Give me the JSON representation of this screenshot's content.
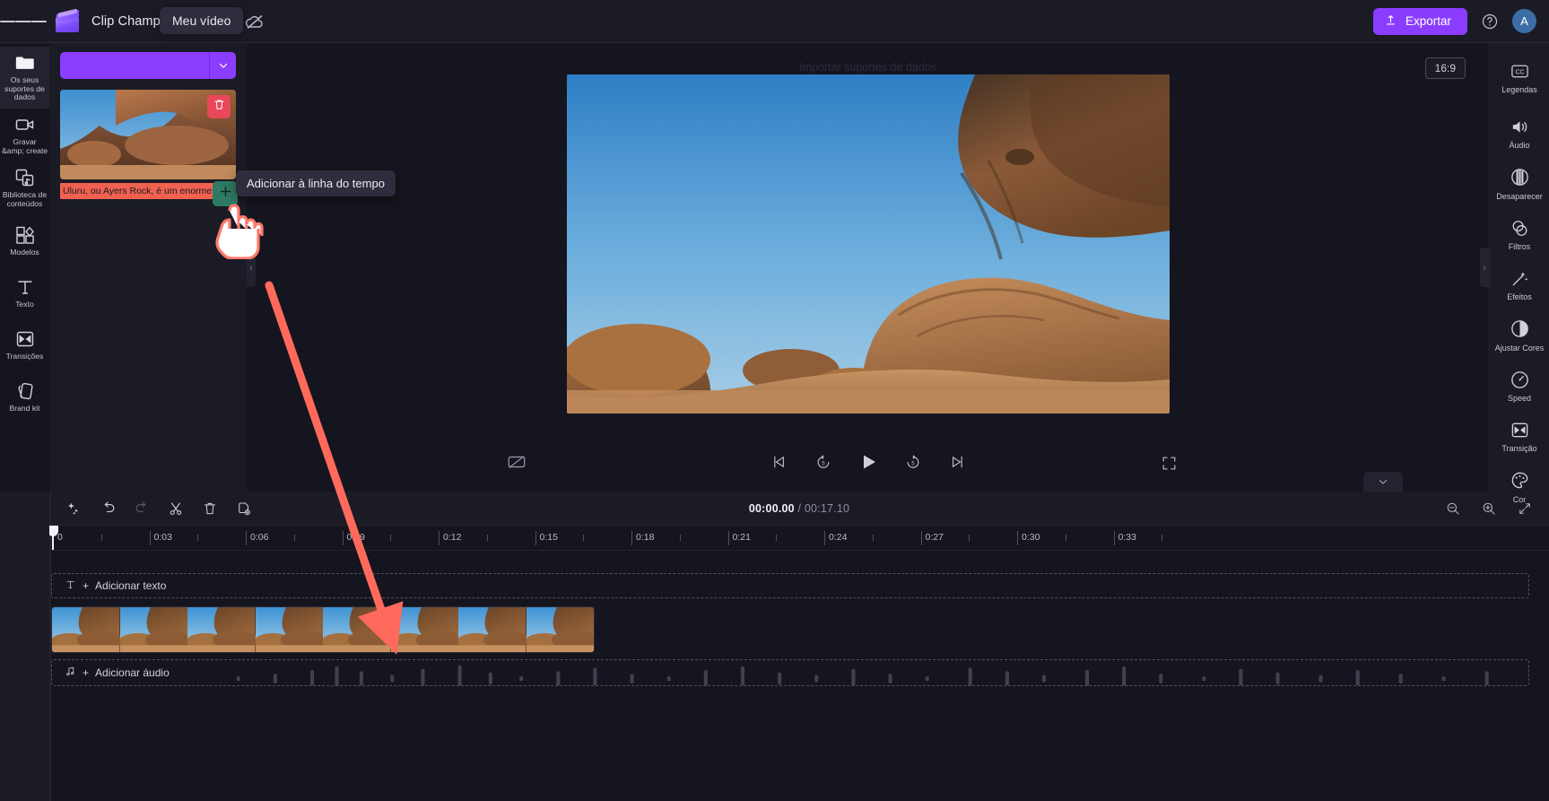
{
  "app": {
    "title": "Clip Champ",
    "project_name": "Meu vídeo",
    "menu_icon": "hamburger-menu-icon",
    "logo_icon": "clipchamp-logo-icon",
    "cloud_off_icon": "cloud-off-icon"
  },
  "topbar": {
    "export_label": "Exportar",
    "export_icon": "upload-icon",
    "help_icon": "help-circle-icon",
    "avatar_initial": "A",
    "accent_color": "#8b3dff",
    "avatar_color": "#3b6ea5"
  },
  "left_rail": {
    "items": [
      {
        "label": "Os seus suportes de dados",
        "icon": "folder-icon",
        "active": true
      },
      {
        "label": "Gravar &amp; create",
        "icon": "video-camera-icon",
        "active": false
      },
      {
        "label": "Biblioteca de conteúdos",
        "icon": "content-library-icon",
        "active": false
      },
      {
        "label": "Modelos",
        "icon": "templates-grid-icon",
        "active": false
      },
      {
        "label": "Texto",
        "icon": "text-t-icon",
        "active": false
      },
      {
        "label": "Transições",
        "icon": "transitions-icon",
        "active": false
      },
      {
        "label": "Brand kit",
        "icon": "brand-kit-icon",
        "active": false
      }
    ]
  },
  "media_panel": {
    "import_button_label": "",
    "import_caret_icon": "chevron-down-icon",
    "delete_icon": "trash-icon",
    "add_icon": "plus-icon",
    "caption_text": "Uluru, ou Ayers Rock, é um enorme s.",
    "caption_bg": "#f0614f",
    "tooltip_text": "Adicionar à linha do tempo",
    "add_button_color": "#2f7a63",
    "delete_button_color": "#e9485a"
  },
  "preview": {
    "import_hint": "Importar suportes de dados",
    "aspect_ratio": "16:9",
    "cc_off_icon": "captions-off-icon",
    "fullscreen_icon": "fullscreen-icon",
    "controls": [
      {
        "name": "skip-to-start",
        "icon": "skip-previous-icon"
      },
      {
        "name": "rewind-5",
        "icon": "replay-5-icon"
      },
      {
        "name": "play",
        "icon": "play-icon"
      },
      {
        "name": "forward-5",
        "icon": "forward-5-icon"
      },
      {
        "name": "skip-to-end",
        "icon": "skip-next-icon"
      }
    ]
  },
  "right_rail": {
    "items": [
      {
        "label": "Legendas",
        "icon": "closed-captions-icon"
      },
      {
        "label": "Áudio",
        "icon": "speaker-icon"
      },
      {
        "label": "Desaparecer",
        "icon": "fade-icon"
      },
      {
        "label": "Filtros",
        "icon": "filters-circles-icon"
      },
      {
        "label": "Efeitos",
        "icon": "magic-wand-icon"
      },
      {
        "label": "Ajustar Cores",
        "icon": "contrast-icon"
      },
      {
        "label": "Speed",
        "icon": "speedometer-icon"
      },
      {
        "label": "Transição",
        "icon": "transitions-icon"
      },
      {
        "label": "Cor",
        "icon": "color-palette-icon"
      }
    ]
  },
  "timeline": {
    "tools": [
      {
        "name": "magic-sparkle",
        "icon": "sparkle-icon",
        "disabled": false
      },
      {
        "name": "undo",
        "icon": "undo-icon",
        "disabled": false
      },
      {
        "name": "redo",
        "icon": "redo-icon",
        "disabled": true
      },
      {
        "name": "split",
        "icon": "scissors-icon",
        "disabled": false
      },
      {
        "name": "delete",
        "icon": "trash-icon",
        "disabled": false
      },
      {
        "name": "duplicate",
        "icon": "duplicate-icon",
        "disabled": false
      }
    ],
    "current_time": "00:00.00",
    "total_time": "/ 00:17.10",
    "zoom_out_icon": "zoom-out-icon",
    "zoom_in_icon": "zoom-in-icon",
    "fit_icon": "fit-to-screen-icon",
    "ruler_labels": [
      "0",
      "0:03",
      "0:06",
      "0:09",
      "0:12",
      "0:15",
      "0:18",
      "0:21",
      "0:24",
      "0:27",
      "0:30",
      "0:33"
    ],
    "text_track": {
      "label": "Adicionar texto",
      "icon": "text-t-icon",
      "plus": "+"
    },
    "audio_track": {
      "label": "Adicionar áudio",
      "icon": "music-note-icon",
      "plus": "+"
    },
    "video_clip_frames": 8
  },
  "annotation": {
    "arrow_color": "#ff6a5c",
    "cursor_icon": "pointing-hand-cursor"
  }
}
